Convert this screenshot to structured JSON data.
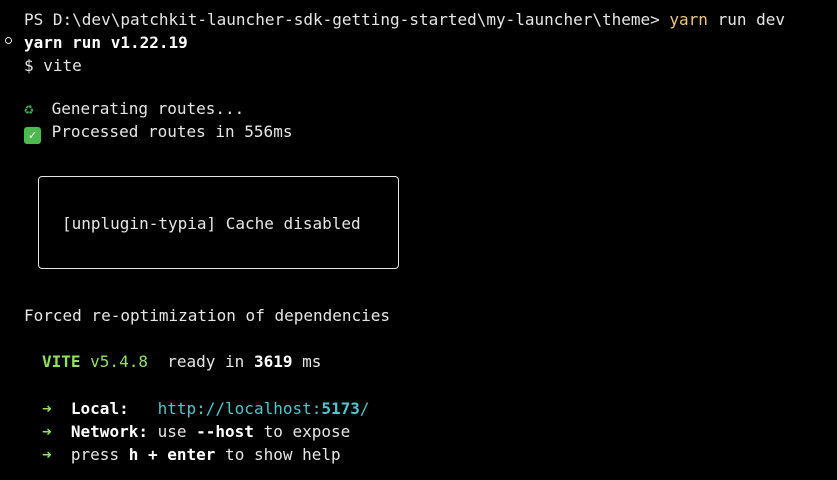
{
  "prompt": {
    "text": "PS D:\\dev\\patchkit-launcher-sdk-getting-started\\my-launcher\\theme> ",
    "command": "yarn",
    "args": " run dev"
  },
  "yarn_header": "yarn run v1.22.19",
  "vite_cmd": "$ vite",
  "generating": {
    "icon": "recycle-icon",
    "text": " Generating routes..."
  },
  "processed": {
    "icon": "check-icon",
    "text": " Processed routes in 556ms"
  },
  "box_message": "[unplugin-typia] Cache disabled",
  "forced_msg": "Forced re-optimization of dependencies",
  "vite_status": {
    "name": "VITE",
    "version": " v5.4.8",
    "ready_text": "  ready in ",
    "ms_value": "3619",
    "ms_unit": " ms"
  },
  "local": {
    "arrow": "➜",
    "label": "Local:",
    "url_prefix": "http://localhost:",
    "port": "5173",
    "url_suffix": "/"
  },
  "network": {
    "arrow": "➜",
    "label": "Network:",
    "pre": " use ",
    "flag": "--host",
    "post": " to expose"
  },
  "help": {
    "arrow": "➜",
    "pre": "press ",
    "key_h": "h",
    "plus": " + ",
    "key_enter": "enter",
    "post": " to show help"
  },
  "colors": {
    "background": "#000000",
    "text": "#e6e6e6",
    "command": "#f0c674",
    "accent_green": "#8fe35b",
    "url_cyan": "#4ec6d0"
  }
}
